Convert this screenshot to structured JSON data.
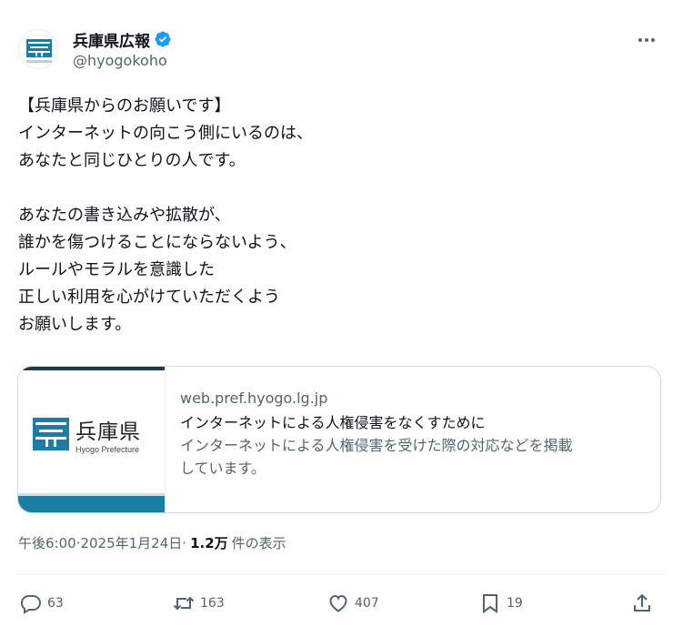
{
  "account": {
    "display_name": "兵庫県広報",
    "handle": "@hyogokoho",
    "verified_icon": "verified-badge-icon",
    "avatar_icon": "hyogo-prefecture-logo"
  },
  "tweet": {
    "lines": [
      "【兵庫県からのお願いです】",
      "インターネットの向こう側にいるのは、",
      "あなたと同じひとりの人です。",
      "",
      "あなたの書き込みや拡散が、",
      "誰かを傷つけることにならないよう、",
      "ルールやモラルを意識した",
      "正しい利用を心がけていただくよう",
      "お願いします。"
    ]
  },
  "card": {
    "brand": "兵庫県",
    "brand_sub": "Hyogo Prefecture",
    "domain": "web.pref.hyogo.lg.jp",
    "title": "インターネットによる人権侵害をなくすために",
    "description_line1": "インターネットによる人権侵害を受けた際の対応などを掲載",
    "description_line2": "しています。"
  },
  "meta": {
    "time": "午後6:00",
    "separator1": " · ",
    "date": "2025年1月24日",
    "separator2": " · ",
    "views": "1.2万",
    "views_label": "件の表示"
  },
  "actions": {
    "replies": "63",
    "retweets": "163",
    "likes": "407",
    "bookmarks": "19"
  },
  "colors": {
    "text": "#0f1419",
    "secondary": "#536471",
    "border": "#cfd9de",
    "verified": "#1d9bf0",
    "brand_blue": "#1b7fa3"
  }
}
